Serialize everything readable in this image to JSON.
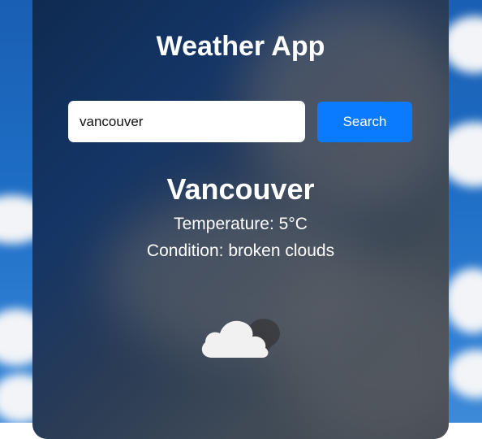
{
  "app": {
    "title": "Weather App"
  },
  "search": {
    "value": "vancouver",
    "button_label": "Search"
  },
  "result": {
    "city": "Vancouver",
    "temperature": "Temperature: 5°C",
    "condition": "Condition: broken clouds",
    "icon": "broken-clouds-icon"
  },
  "colors": {
    "accent": "#0a7bff",
    "text": "#ffffff",
    "input_bg": "#ffffff"
  }
}
